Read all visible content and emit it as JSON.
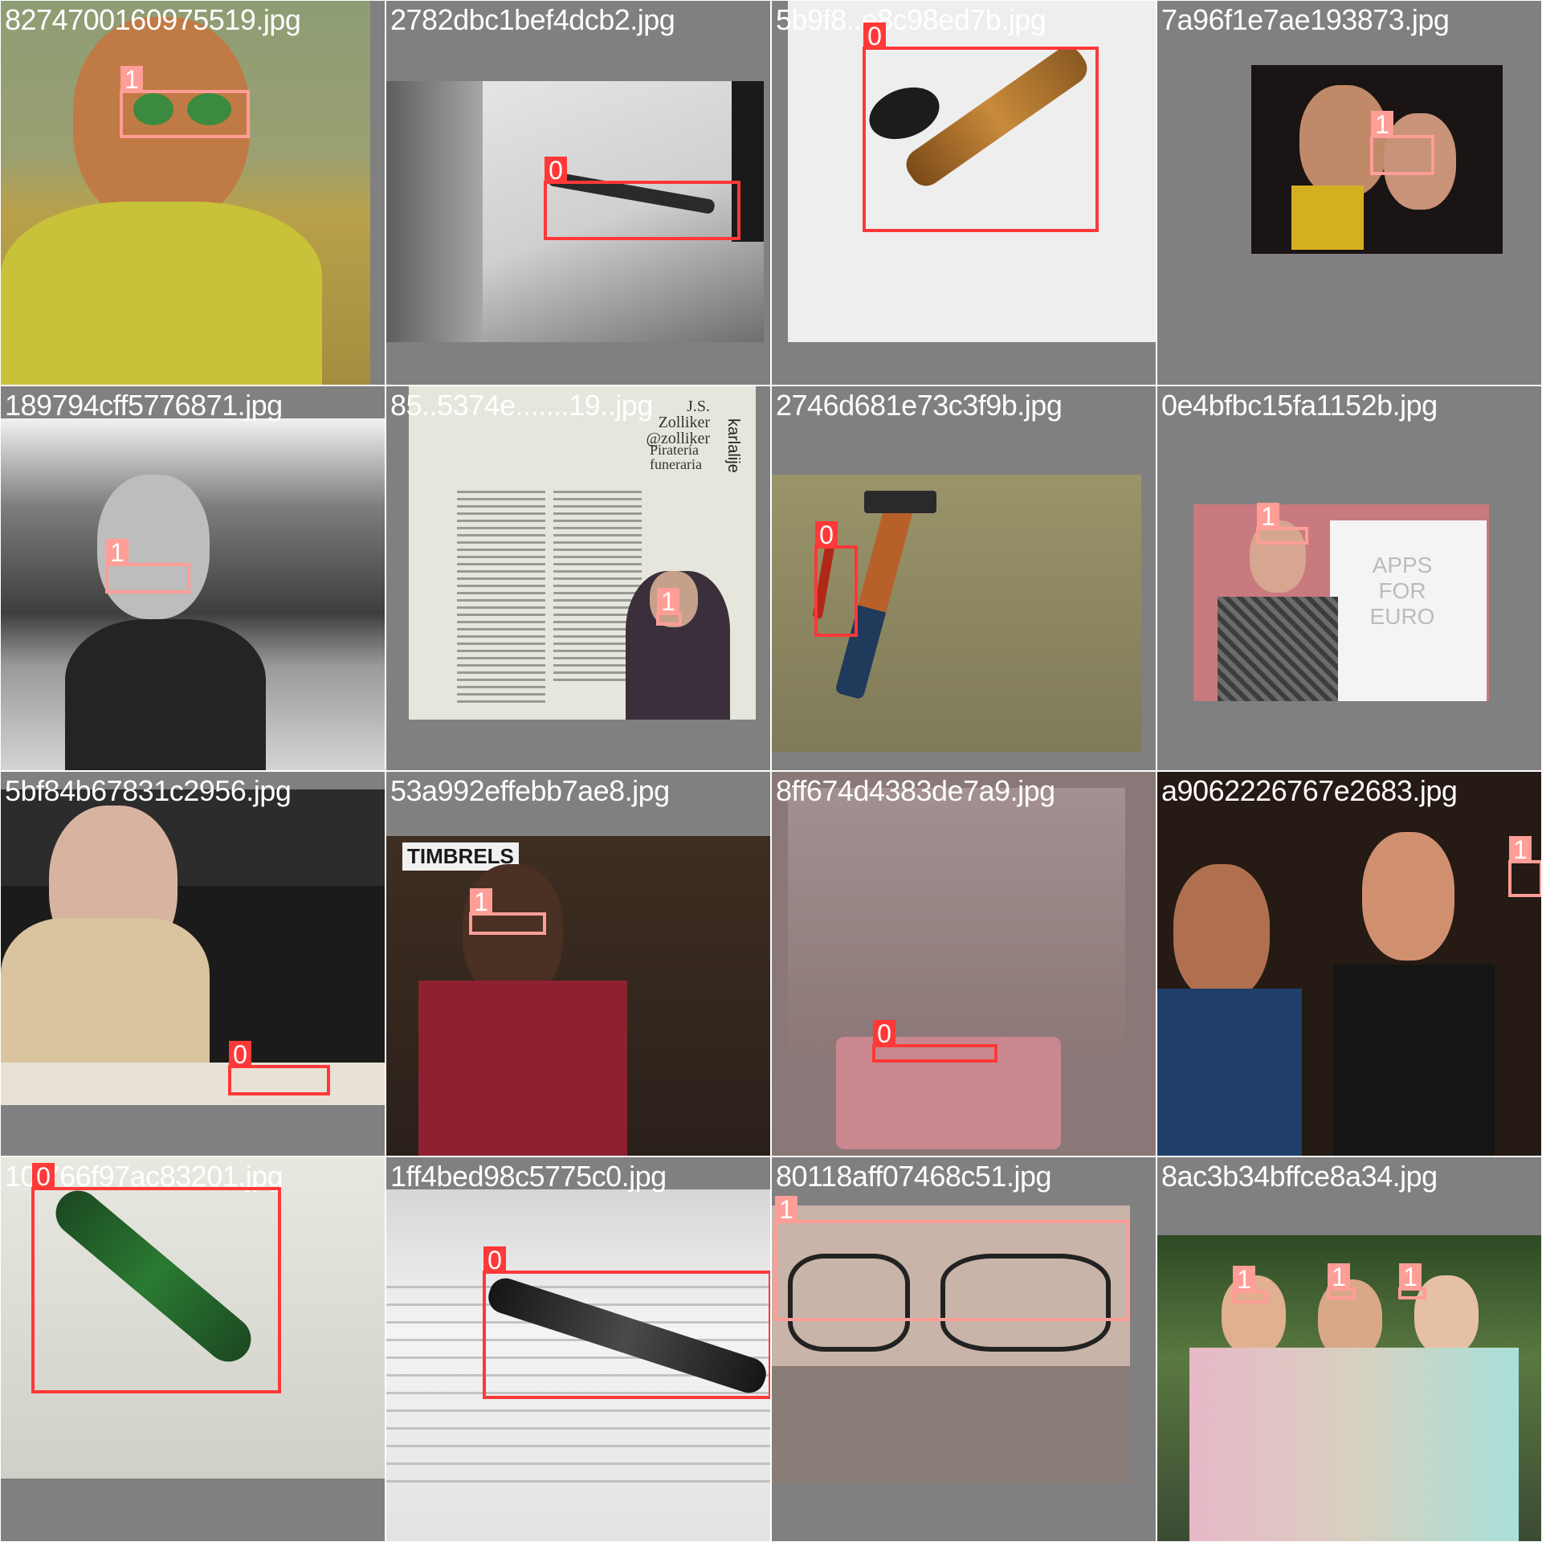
{
  "tiles": [
    {
      "filename": "8274700160975519.jpg",
      "boxes": [
        {
          "label": "1"
        }
      ]
    },
    {
      "filename": "2782dbc1bef4dcb2.jpg",
      "boxes": [
        {
          "label": "0"
        }
      ]
    },
    {
      "filename": "5b9f8..e8c98ed7b.jpg",
      "boxes": [
        {
          "label": "0"
        }
      ]
    },
    {
      "filename": "7a96f1e7ae193873.jpg",
      "boxes": [
        {
          "label": "1"
        }
      ]
    },
    {
      "filename": "189794cff5776871.jpg",
      "boxes": [
        {
          "label": "1"
        }
      ]
    },
    {
      "filename": "85..5374e.......19..jpg",
      "boxes": [
        {
          "label": "1"
        }
      ],
      "text": {
        "byline_1": "J.S.",
        "byline_2": "Zolliker",
        "byline_3": "@zolliker",
        "heading_1": "Piratería",
        "heading_2": "funeraria",
        "side": "karlalije"
      }
    },
    {
      "filename": "2746d681e73c3f9b.jpg",
      "boxes": [
        {
          "label": "0"
        }
      ]
    },
    {
      "filename": "0e4bfbc15fa1152b.jpg",
      "boxes": [
        {
          "label": "1"
        }
      ],
      "text": {
        "banner": "APPS FOR EURO"
      }
    },
    {
      "filename": "5bf84b67831c2956.jpg",
      "boxes": [
        {
          "label": "0"
        }
      ]
    },
    {
      "filename": "53a992effebb7ae8.jpg",
      "boxes": [
        {
          "label": "1"
        }
      ],
      "text": {
        "sign": "TIMBRELS"
      }
    },
    {
      "filename": "8ff674d4383de7a9.jpg",
      "boxes": [
        {
          "label": "0"
        }
      ]
    },
    {
      "filename": "a9062226767e2683.jpg",
      "boxes": [
        {
          "label": "1"
        }
      ]
    },
    {
      "filename": "10.766f97ac83201.jpg",
      "boxes": [
        {
          "label": "0"
        }
      ]
    },
    {
      "filename": "1ff4bed98c5775c0.jpg",
      "boxes": [
        {
          "label": "0"
        }
      ]
    },
    {
      "filename": "80118aff07468c51.jpg",
      "boxes": [
        {
          "label": "1"
        }
      ]
    },
    {
      "filename": "8ac3b34bffce8a34.jpg",
      "boxes": [
        {
          "label": "1"
        },
        {
          "label": "1"
        },
        {
          "label": "1"
        }
      ]
    }
  ],
  "colors": {
    "class_0": "#ff3838",
    "class_1": "#ff9d97",
    "tile_background": "#808080",
    "filename_text": "#ffffff"
  }
}
